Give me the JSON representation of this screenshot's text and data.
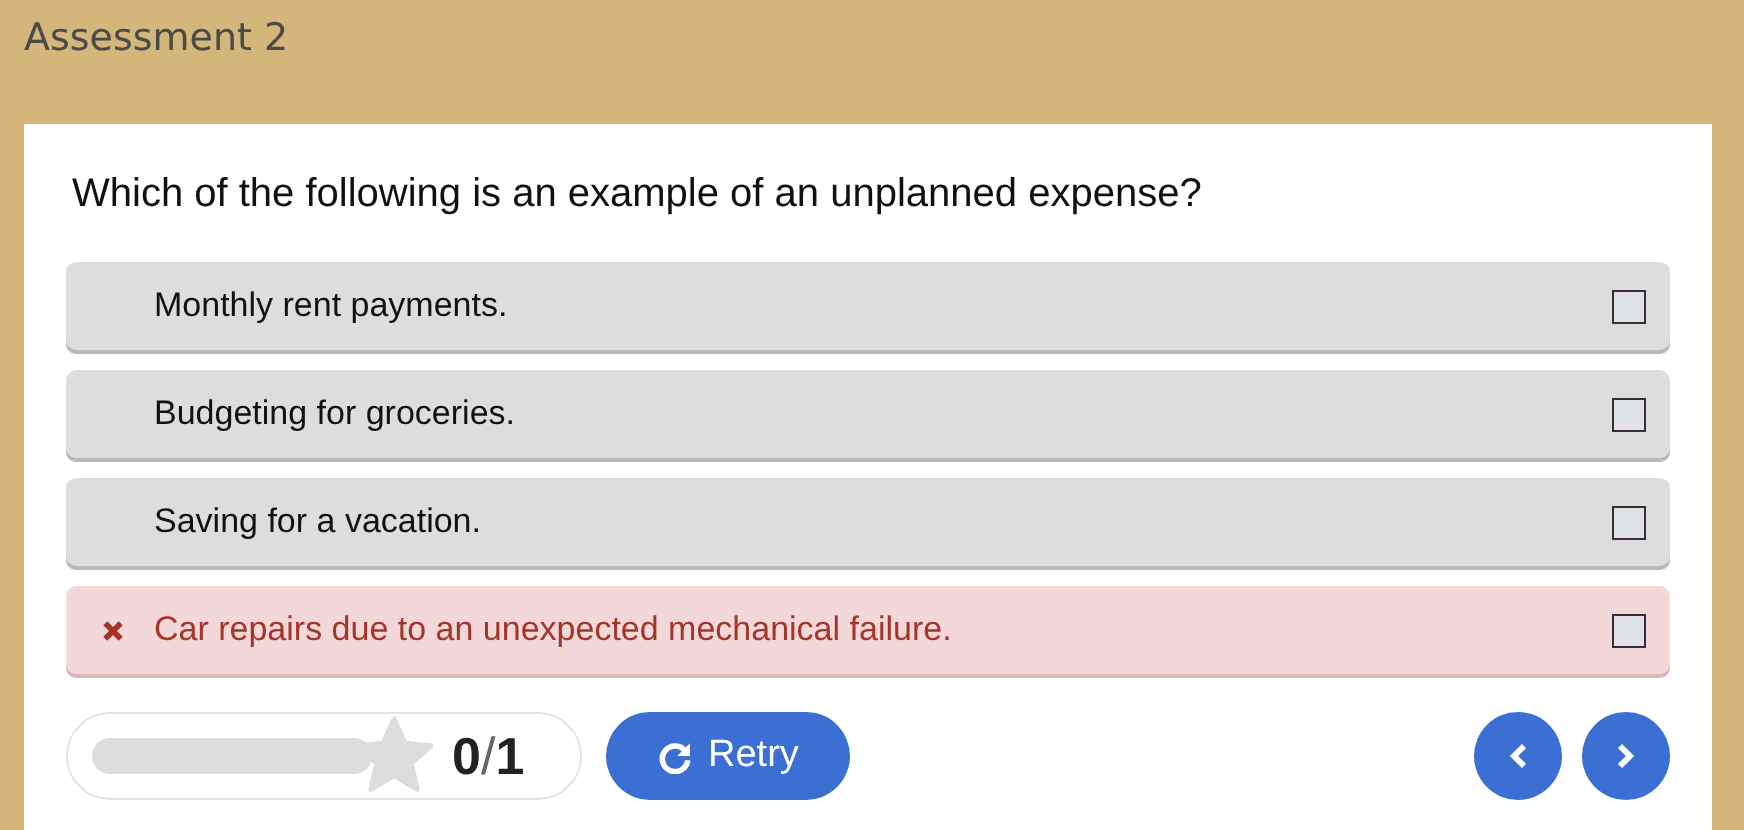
{
  "header": {
    "title": "Assessment 2"
  },
  "question": "Which of the following is an example of an unplanned expense?",
  "options": [
    {
      "label": "Monthly rent payments.",
      "incorrect": false,
      "checked": false
    },
    {
      "label": "Budgeting for groceries.",
      "incorrect": false,
      "checked": false
    },
    {
      "label": "Saving for a vacation.",
      "incorrect": false,
      "checked": false
    },
    {
      "label": "Car repairs due to an unexpected mechanical failure.",
      "incorrect": true,
      "checked": false
    }
  ],
  "progress": {
    "level": 0,
    "score": "0",
    "separator": "/",
    "total": "1"
  },
  "retry_button": {
    "label": "Retry"
  }
}
